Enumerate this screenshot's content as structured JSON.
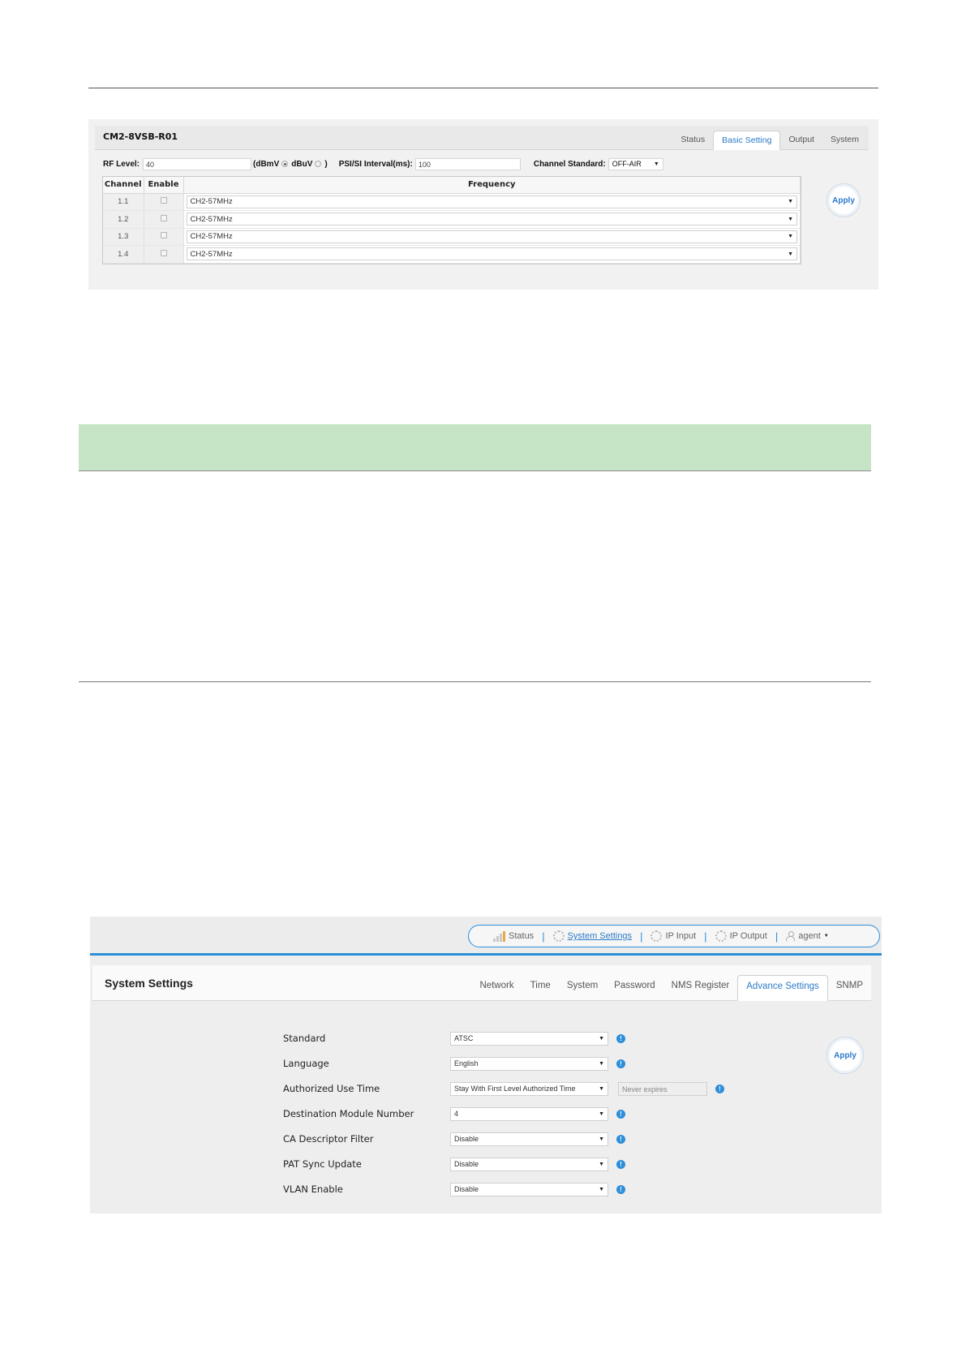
{
  "panel1": {
    "title": "CM2-8VSB-R01",
    "tabs": [
      {
        "label": "Status",
        "active": false
      },
      {
        "label": "Basic Setting",
        "active": true
      },
      {
        "label": "Output",
        "active": false
      },
      {
        "label": "System",
        "active": false
      }
    ],
    "rf_level_label": "RF Level:",
    "rf_level_value": "40",
    "unit_open": "(dBmV",
    "unit_dbuv": "dBuV",
    "unit_close": ")",
    "psi_label": "PSI/SI Interval(ms):",
    "psi_value": "100",
    "channel_standard_label": "Channel Standard:",
    "channel_standard_value": "OFF-AIR",
    "table_headers": {
      "channel": "Channel",
      "enable": "Enable",
      "frequency": "Frequency"
    },
    "rows": [
      {
        "channel": "1.1",
        "enabled": false,
        "frequency": "CH2-57MHz"
      },
      {
        "channel": "1.2",
        "enabled": false,
        "frequency": "CH2-57MHz"
      },
      {
        "channel": "1.3",
        "enabled": false,
        "frequency": "CH2-57MHz"
      },
      {
        "channel": "1.4",
        "enabled": false,
        "frequency": "CH2-57MHz"
      }
    ],
    "apply_label": "Apply"
  },
  "panel2": {
    "nav": {
      "status": "Status",
      "system_settings": "System Settings",
      "ip_input": "IP Input",
      "ip_output": "IP Output",
      "user": "agent"
    },
    "title": "System Settings",
    "tabs": [
      {
        "label": "Network",
        "active": false
      },
      {
        "label": "Time",
        "active": false
      },
      {
        "label": "System",
        "active": false
      },
      {
        "label": "Password",
        "active": false
      },
      {
        "label": "NMS Register",
        "active": false
      },
      {
        "label": "Advance Settings",
        "active": true
      },
      {
        "label": "SNMP",
        "active": false
      }
    ],
    "fields": {
      "standard": {
        "label": "Standard",
        "value": "ATSC"
      },
      "language": {
        "label": "Language",
        "value": "English"
      },
      "authorized_use_time": {
        "label": "Authorized Use Time",
        "value": "Stay With First Level Authorized Time",
        "extra": "Never expires"
      },
      "destination_module_number": {
        "label": "Destination Module Number",
        "value": "4"
      },
      "ca_descriptor_filter": {
        "label": "CA Descriptor Filter",
        "value": "Disable"
      },
      "pat_sync_update": {
        "label": "PAT Sync Update",
        "value": "Disable"
      },
      "vlan_enable": {
        "label": "VLAN Enable",
        "value": "Disable"
      }
    },
    "apply_label": "Apply"
  },
  "colors": {
    "accent": "#2d8ed9",
    "highlight_bar": "#c6e5c6"
  }
}
